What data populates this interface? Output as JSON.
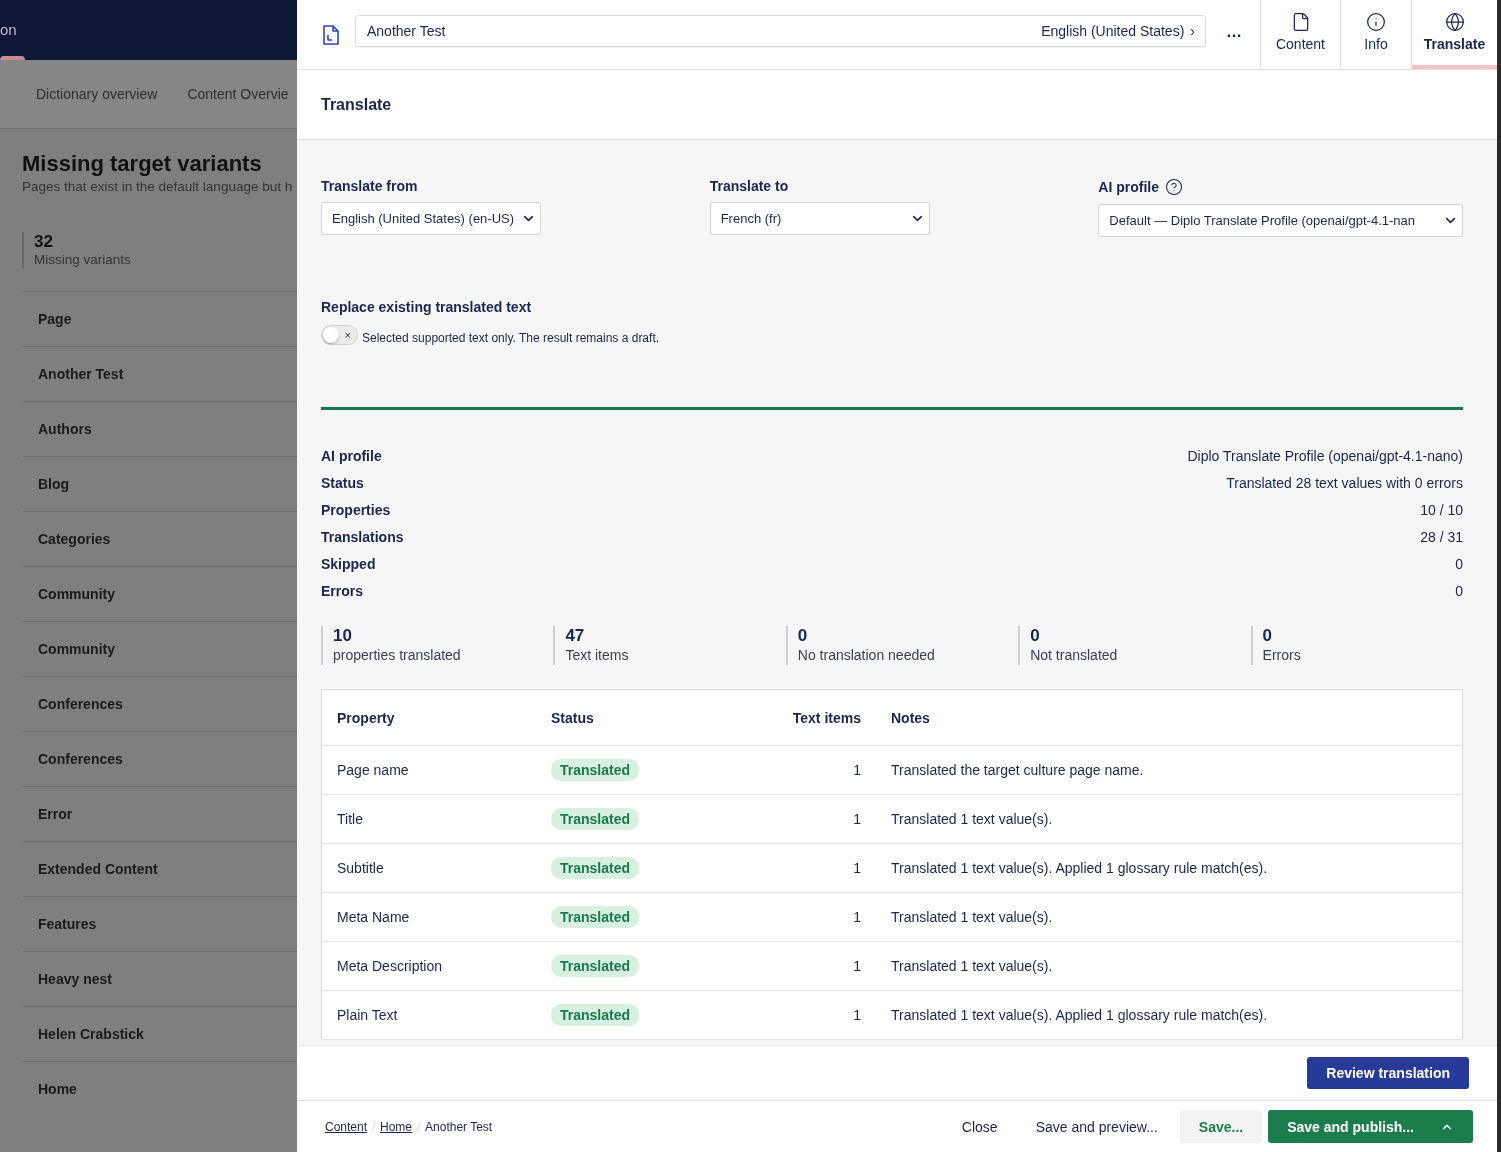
{
  "background_page": {
    "header_text": "on",
    "tabs": [
      "Dictionary overview",
      "Content Overvie"
    ],
    "title": "Missing target variants",
    "subtitle": "Pages that exist in the default language but h",
    "stat": {
      "value": "32",
      "label": "Missing variants"
    },
    "items": [
      "Page",
      "Another Test",
      "Authors",
      "Blog",
      "Categories",
      "Community",
      "Community",
      "Conferences",
      "Conferences",
      "Error",
      "Extended Content",
      "Features",
      "Heavy nest",
      "Helen Crabstick",
      "Home"
    ]
  },
  "panel": {
    "name_field": {
      "value": "Another Test",
      "culture": "English (United States)",
      "chevron": "›"
    },
    "more_button": "…",
    "tabs": [
      {
        "label": "Content",
        "kind": "document",
        "selected": false
      },
      {
        "label": "Info",
        "kind": "info",
        "selected": false
      },
      {
        "label": "Translate",
        "kind": "globe",
        "selected": true
      }
    ],
    "title": "Translate",
    "form": {
      "fields": [
        {
          "label": "Translate from",
          "value": "English (United States) (en-US)",
          "help": false
        },
        {
          "label": "Translate to",
          "value": "French (fr)",
          "help": false
        },
        {
          "label": "AI profile",
          "value": "Default — Diplo Translate Profile (openai/gpt-4.1-nan",
          "help": true
        }
      ],
      "replace": {
        "label": "Replace existing translated text",
        "on": false,
        "off_glyph": "×",
        "hint": "Selected supported text only. The result remains a draft."
      }
    },
    "summary": [
      {
        "label": "AI profile",
        "value": "Diplo Translate Profile (openai/gpt-4.1-nano)"
      },
      {
        "label": "Status",
        "value": "Translated 28 text values with 0 errors"
      },
      {
        "label": "Properties",
        "value": "10 / 10"
      },
      {
        "label": "Translations",
        "value": "28 / 31"
      },
      {
        "label": "Skipped",
        "value": "0"
      },
      {
        "label": "Errors",
        "value": "0"
      }
    ],
    "stats": [
      {
        "value": "10",
        "label": "properties translated"
      },
      {
        "value": "47",
        "label": "Text items"
      },
      {
        "value": "0",
        "label": "No translation needed"
      },
      {
        "value": "0",
        "label": "Not translated"
      },
      {
        "value": "0",
        "label": "Errors"
      }
    ],
    "table": {
      "columns": [
        "Property",
        "Status",
        "Text items",
        "Notes"
      ],
      "rows": [
        {
          "property": "Page name",
          "status": {
            "label": "Translated",
            "kind": "translated"
          },
          "text_items": "1",
          "notes": "Translated the target culture page name."
        },
        {
          "property": "Title",
          "status": {
            "label": "Translated",
            "kind": "translated"
          },
          "text_items": "1",
          "notes": "Translated 1 text value(s)."
        },
        {
          "property": "Subtitle",
          "status": {
            "label": "Translated",
            "kind": "translated"
          },
          "text_items": "1",
          "notes": "Translated 1 text value(s). Applied 1 glossary rule match(es)."
        },
        {
          "property": "Meta Name",
          "status": {
            "label": "Translated",
            "kind": "translated"
          },
          "text_items": "1",
          "notes": "Translated 1 text value(s)."
        },
        {
          "property": "Meta Description",
          "status": {
            "label": "Translated",
            "kind": "translated"
          },
          "text_items": "1",
          "notes": "Translated 1 text value(s)."
        },
        {
          "property": "Plain Text",
          "status": {
            "label": "Translated",
            "kind": "translated"
          },
          "text_items": "1",
          "notes": "Translated 1 text value(s). Applied 1 glossary rule match(es)."
        }
      ]
    },
    "review_button": "Review translation",
    "breadcrumbs": [
      {
        "label": "Content",
        "link": true
      },
      {
        "label": "Home",
        "link": true
      },
      {
        "label": "Another Test",
        "link": false
      }
    ],
    "actions": [
      {
        "label": "Close",
        "kind": "plain"
      },
      {
        "label": "Save and preview...",
        "kind": "plain"
      },
      {
        "label": "Save...",
        "kind": "secondary"
      },
      {
        "label": "Save and publish...",
        "kind": "primary"
      }
    ]
  }
}
